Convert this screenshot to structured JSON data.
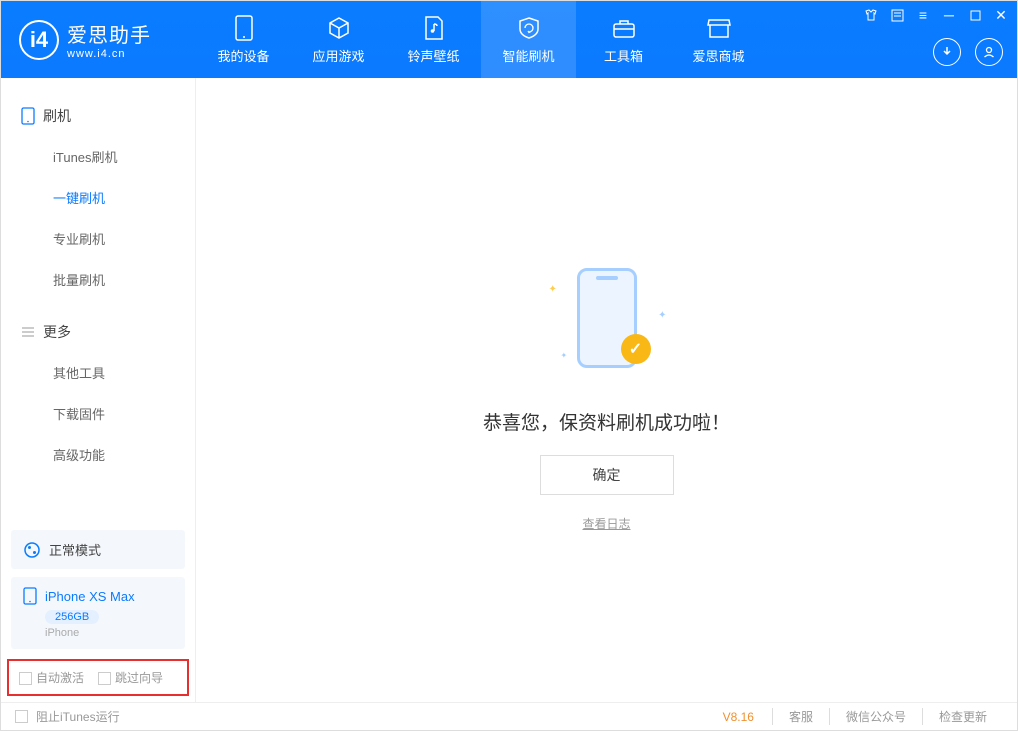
{
  "app": {
    "name_cn": "爱思助手",
    "name_en": "www.i4.cn"
  },
  "nav": [
    {
      "label": "我的设备"
    },
    {
      "label": "应用游戏"
    },
    {
      "label": "铃声壁纸"
    },
    {
      "label": "智能刷机"
    },
    {
      "label": "工具箱"
    },
    {
      "label": "爱思商城"
    }
  ],
  "sidebar": {
    "group1_title": "刷机",
    "items1": [
      "iTunes刷机",
      "一键刷机",
      "专业刷机",
      "批量刷机"
    ],
    "group2_title": "更多",
    "items2": [
      "其他工具",
      "下载固件",
      "高级功能"
    ]
  },
  "mode": {
    "label": "正常模式"
  },
  "device": {
    "name": "iPhone XS Max",
    "storage": "256GB",
    "type": "iPhone"
  },
  "options": {
    "auto_activate": "自动激活",
    "skip_guide": "跳过向导"
  },
  "result": {
    "message": "恭喜您，保资料刷机成功啦！",
    "ok_label": "确定",
    "log_link": "查看日志"
  },
  "footer": {
    "block_itunes": "阻止iTunes运行",
    "version": "V8.16",
    "links": [
      "客服",
      "微信公众号",
      "检查更新"
    ]
  }
}
